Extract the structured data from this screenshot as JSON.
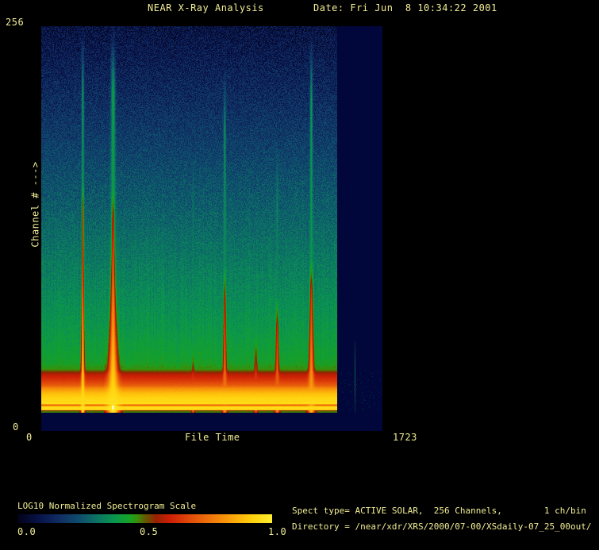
{
  "header": {
    "title": "NEAR X-Ray Analysis",
    "date": "Date: Fri Jun  8 10:34:22 2001"
  },
  "axes": {
    "y_max": "256",
    "y_min": "0",
    "y_label": "Channel # --->",
    "x_min": "0",
    "x_label": "File Time",
    "x_max": "1723"
  },
  "colorbar": {
    "label": "LOG10 Normalized Spectrogram Scale",
    "ticks": [
      "0.0",
      "0.5",
      "1.0"
    ]
  },
  "info": {
    "spect_type_line": "Spect type= ACTIVE SOLAR,  256 Channels,        1 ch/bin",
    "directory_line": "Directory = /near/xdr/XRS/2000/07-00/XSdaily-07_25_00out/"
  },
  "colors": {
    "text": "#f2ee96",
    "background": "#000000",
    "plot_background": "#01073a"
  },
  "chart_data": {
    "type": "heatmap",
    "title": "NEAR X-Ray Analysis",
    "xlabel": "File Time",
    "ylabel": "Channel #",
    "xlim": [
      0,
      1723
    ],
    "ylim": [
      0,
      256
    ],
    "colorbar_label": "LOG10 Normalized Spectrogram Scale",
    "colorbar_range": [
      0.0,
      1.0
    ],
    "legend": "none",
    "grid": false,
    "data_time_extent": [
      0,
      1494
    ],
    "data_height_frac": 0.955,
    "plot_bg_rgb": [
      1,
      7,
      58
    ],
    "palette_stops": [
      [
        0.0,
        [
          2,
          2,
          26
        ]
      ],
      [
        0.08,
        [
          8,
          18,
          72
        ]
      ],
      [
        0.16,
        [
          16,
          44,
          98
        ]
      ],
      [
        0.24,
        [
          14,
          76,
          110
        ]
      ],
      [
        0.32,
        [
          12,
          120,
          98
        ]
      ],
      [
        0.38,
        [
          10,
          150,
          78
        ]
      ],
      [
        0.44,
        [
          22,
          162,
          36
        ]
      ],
      [
        0.47,
        [
          58,
          142,
          10
        ]
      ],
      [
        0.5,
        [
          96,
          92,
          0
        ]
      ],
      [
        0.545,
        [
          152,
          32,
          0
        ]
      ],
      [
        0.6,
        [
          205,
          32,
          6
        ]
      ],
      [
        0.68,
        [
          226,
          76,
          10
        ]
      ],
      [
        0.76,
        [
          240,
          118,
          10
        ]
      ],
      [
        0.84,
        [
          250,
          162,
          10
        ]
      ],
      [
        0.92,
        [
          255,
          208,
          12
        ]
      ],
      [
        1.0,
        [
          255,
          238,
          46
        ]
      ]
    ],
    "background_value_profile": [
      [
        0.0,
        0.075
      ],
      [
        0.2,
        0.16
      ],
      [
        0.4,
        0.245
      ],
      [
        0.6,
        0.32
      ],
      [
        0.78,
        0.385
      ],
      [
        0.87,
        0.43
      ],
      [
        0.889,
        0.47
      ],
      [
        0.901,
        0.575
      ],
      [
        0.918,
        0.645
      ],
      [
        0.93,
        0.71
      ],
      [
        0.938,
        0.8
      ],
      [
        0.95,
        0.885
      ],
      [
        0.965,
        0.935
      ],
      [
        0.978,
        0.95
      ],
      [
        0.9805,
        0.74
      ],
      [
        0.9825,
        0.74
      ],
      [
        0.986,
        0.95
      ],
      [
        0.9935,
        0.95
      ],
      [
        0.996,
        0.5
      ],
      [
        1.0,
        0.48
      ]
    ],
    "noise": {
      "seed": 1234567,
      "top_amp": 0.082,
      "stripe_amp": 0.016
    },
    "bursts": [
      {
        "time": 208,
        "onset": 0.0,
        "halo_w": 1.6,
        "halo_level": 0.37,
        "red_onset": 0.4,
        "core_w": 1.1,
        "red_max": 0.97,
        "flare": 1.2,
        "hot_spot": false
      },
      {
        "time": 361,
        "onset": 0.0,
        "halo_w": 2.8,
        "halo_level": 0.4,
        "red_onset": 0.42,
        "core_w": 1.5,
        "red_max": 0.98,
        "flare": 4.5,
        "hot_spot": true
      },
      {
        "time": 765,
        "onset": 0.32,
        "halo_w": 1.1,
        "halo_level": 0.31,
        "red_onset": 0.84,
        "core_w": 0.9,
        "red_max": 0.72,
        "flare": 1.0,
        "hot_spot": false
      },
      {
        "time": 925,
        "onset": 0.1,
        "halo_w": 1.5,
        "halo_level": 0.36,
        "red_onset": 0.62,
        "core_w": 1.0,
        "red_max": 0.8,
        "flare": 1.8,
        "hot_spot": false
      },
      {
        "time": 1082,
        "onset": 0.45,
        "halo_w": 1.1,
        "halo_level": 0.3,
        "red_onset": 0.8,
        "core_w": 0.9,
        "red_max": 0.7,
        "flare": 1.5,
        "hot_spot": false
      },
      {
        "time": 1190,
        "onset": 0.3,
        "halo_w": 1.4,
        "halo_level": 0.33,
        "red_onset": 0.7,
        "core_w": 1.0,
        "red_max": 0.78,
        "flare": 1.8,
        "hot_spot": false
      },
      {
        "time": 1362,
        "onset": 0.02,
        "halo_w": 1.7,
        "halo_level": 0.38,
        "red_onset": 0.6,
        "core_w": 1.3,
        "red_max": 0.88,
        "flare": 2.2,
        "hot_spot": false
      }
    ],
    "red_level_start": 0.56,
    "isolated_trace": {
      "time": 1583,
      "start_frac": 0.815,
      "rgb": [
        12,
        110,
        72
      ]
    },
    "margin_speckle": {
      "count": 160,
      "y_frac_range": [
        0.85,
        0.95
      ],
      "rgb": [
        18,
        95,
        70
      ]
    }
  }
}
